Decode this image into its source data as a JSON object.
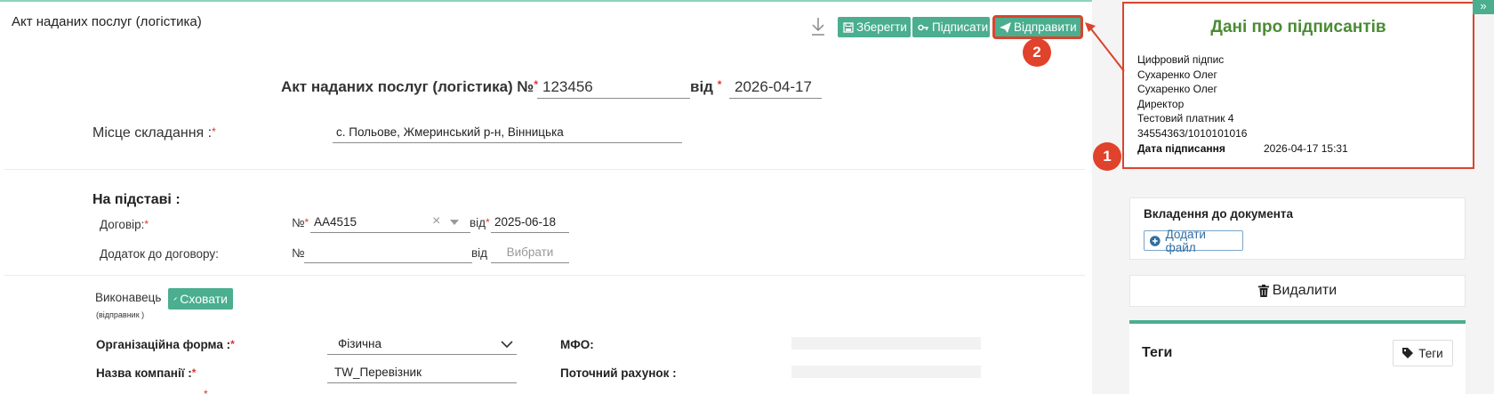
{
  "page": {
    "title": "Акт наданих послуг (логістика)"
  },
  "toolbar": {
    "save_label": "Зберегти",
    "sign_label": "Підписати",
    "send_label": "Відправити"
  },
  "badges": {
    "one": "1",
    "two": "2"
  },
  "document": {
    "heading": "Акт наданих послуг (логістика) №",
    "number": "123456",
    "date_label": "від",
    "date": "2026-04-17",
    "place_label": "Місце складання :",
    "place_value": "с. Польове, Жмеринський р-н, Вінницька"
  },
  "basis": {
    "title": "На підставі :",
    "contract_label": "Договір:",
    "no_symbol": "№",
    "contract_number": "АА4515",
    "from_label": "від",
    "contract_date": "2025-06-18",
    "addendum_label": "Додаток до договору:",
    "addendum_number": "",
    "addendum_date_placeholder": "Вибрати"
  },
  "executor": {
    "title": "Виконавець",
    "subtitle": "(відправник )",
    "hide_label": "Сховати",
    "org_form_label": "Організаційна форма :",
    "org_form_value": "Фізична",
    "company_label": "Назва компанії :",
    "company_value": "TW_Перевізник",
    "mfo_label": "МФО:",
    "account_label": "Поточний рахунок :"
  },
  "signers": {
    "title": "Дані про підписантів",
    "lines": [
      "Цифровий підпис",
      "Сухаренко Олег",
      "Сухаренко Олег",
      "Директор",
      "Тестовий платник 4",
      "34554363/1010101016"
    ],
    "sign_date_label": "Дата підписання",
    "sign_date_value": "2026-04-17 15:31"
  },
  "attachments": {
    "title": "Вкладення до документа",
    "add_label": "Додати файл"
  },
  "delete_label": "Видалити",
  "tags": {
    "title": "Теги",
    "button_label": "Теги"
  },
  "colors": {
    "accent": "#4aae8f",
    "highlight": "#d9442e",
    "signer_title": "#4b8a35"
  }
}
